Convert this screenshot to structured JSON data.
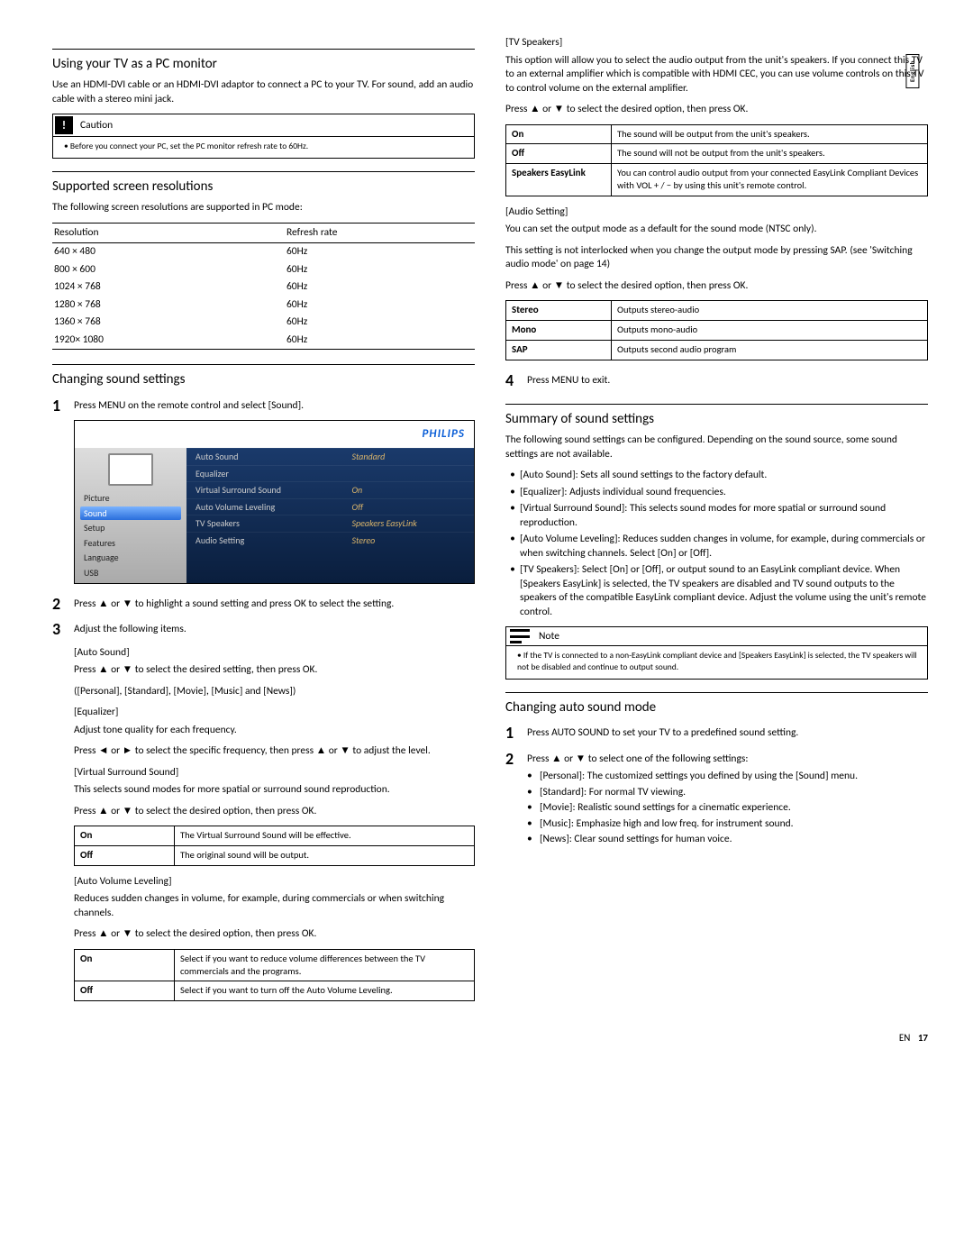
{
  "lang_tab": "English",
  "left": {
    "h1": "Using your TV as a PC monitor",
    "p1": "Use an HDMI-DVI cable or an HDMI-DVI adaptor to connect a PC to your TV. For sound, add an audio cable with a stereo mini jack.",
    "caution_title": "Caution",
    "caution_body": "Before you connect your PC, set the PC monitor refresh rate to 60Hz.",
    "h2": "Supported screen resolutions",
    "p2": "The following screen resolutions are supported in PC mode:",
    "res_headers": [
      "Resolution",
      "Refresh rate"
    ],
    "resolutions": [
      [
        "640 × 480",
        "60Hz"
      ],
      [
        "800 × 600",
        "60Hz"
      ],
      [
        "1024 × 768",
        "60Hz"
      ],
      [
        "1280 × 768",
        "60Hz"
      ],
      [
        "1360 × 768",
        "60Hz"
      ],
      [
        "1920× 1080",
        "60Hz"
      ]
    ],
    "h3": "Changing sound settings",
    "step1": "Press MENU on the remote control and select [Sound].",
    "osd_logo": "PHILIPS",
    "osd_left": [
      "Picture",
      "Sound",
      "Setup",
      "Features",
      "Language",
      "USB"
    ],
    "osd_rows": [
      {
        "lbl": "Auto Sound",
        "val": "Standard"
      },
      {
        "lbl": "Equalizer",
        "val": ""
      },
      {
        "lbl": "Virtual Surround Sound",
        "val": "On"
      },
      {
        "lbl": "Auto Volume Leveling",
        "val": "Off"
      },
      {
        "lbl": "TV Speakers",
        "val": "Speakers EasyLink"
      },
      {
        "lbl": "Audio Setting",
        "val": "Stereo"
      }
    ],
    "step2": "Press ▲ or ▼ to highlight a sound setting and press OK to select the setting.",
    "step3": "Adjust the following items.",
    "autosound_h": "Auto Sound",
    "autosound_p1": "Press ▲ or ▼ to select the desired setting, then press OK.",
    "autosound_p2": "([Personal], [Standard], [Movie], [Music] and [News])",
    "eq_h": "Equalizer",
    "eq_p1": "Adjust tone quality for each frequency.",
    "eq_p2": "Press ◄ or ► to select the specific frequency, then press ▲ or ▼ to adjust the level.",
    "vss_h": "Virtual Surround Sound",
    "vss_p1": "This selects sound modes for more spatial or surround sound reproduction.",
    "vss_p2": "Press ▲ or ▼ to select the desired option, then press OK.",
    "vss_table": [
      [
        "On",
        "The Virtual Surround Sound will be effective."
      ],
      [
        "Off",
        "The original sound will be output."
      ]
    ],
    "avl_h": "Auto Volume Leveling",
    "avl_p1": "Reduces sudden changes in volume, for example, during commercials or when switching channels.",
    "avl_p2": "Press ▲ or ▼ to select the desired option, then press OK.",
    "avl_table": [
      [
        "On",
        "Select if you want to reduce volume differences between the TV commercials and the programs."
      ],
      [
        "Off",
        "Select if you want to turn off the Auto Volume Leveling."
      ]
    ]
  },
  "right": {
    "tvs_h": "TV Speakers",
    "tvs_p1": "This option will allow you to select the audio output from the unit's speakers. If you connect this TV to an external amplifier which is compatible with HDMI CEC, you can use volume controls on this TV to control volume on the external amplifier.",
    "tvs_p2": "Press ▲ or ▼ to select the desired option, then press OK.",
    "tvs_table": [
      [
        "On",
        "The sound will be output from the unit's speakers."
      ],
      [
        "Off",
        "The sound will not be output from the unit's speakers."
      ],
      [
        "Speakers EasyLink",
        "You can control audio output from your connected EasyLink Compliant Devices with VOL + / − by using this unit's remote control."
      ]
    ],
    "aud_h": "Audio Setting",
    "aud_p1": "You can set the output mode as a default for the sound mode (NTSC only).",
    "aud_p2": "This setting is not interlocked when you change the output mode by pressing SAP. (see 'Switching audio mode' on page 14)",
    "aud_p3": "Press ▲ or ▼ to select the desired option, then press OK.",
    "aud_table": [
      [
        "Stereo",
        "Outputs stereo-audio"
      ],
      [
        "Mono",
        "Outputs mono-audio"
      ],
      [
        "SAP",
        "Outputs second audio program"
      ]
    ],
    "step4": "Press MENU to exit.",
    "h4": "Summary of sound settings",
    "p4": "The following sound settings can be configured. Depending on the sound source, some sound settings are not available.",
    "summary": [
      "[Auto Sound]: Sets all sound settings to the factory default.",
      "[Equalizer]: Adjusts individual sound frequencies.",
      "[Virtual Surround Sound]: This selects sound modes for more spatial or surround sound reproduction.",
      "[Auto Volume Leveling]: Reduces sudden changes in volume, for example, during commercials or when switching channels. Select [On] or [Off].",
      "[TV Speakers]: Select [On] or [Off], or output sound to an EasyLink compliant device. When [Speakers EasyLink] is selected, the TV speakers are disabled and TV sound outputs to the speakers of the compatible EasyLink compliant device. Adjust the volume using the unit's remote control."
    ],
    "note_title": "Note",
    "note_body": "If the TV is connected to a non-EasyLink compliant device and [Speakers EasyLink] is selected, the TV speakers will not be disabled and continue to output sound.",
    "h5": "Changing auto sound mode",
    "cas_step1": "Press AUTO SOUND to set your TV to a predefined sound setting.",
    "cas_step2": "Press ▲ or ▼ to select one of the following settings:",
    "cas_list": [
      "[Personal]: The customized settings you defined by using the [Sound] menu.",
      "[Standard]: For normal TV viewing.",
      "[Movie]: Realistic sound settings for a cinematic experience.",
      "[Music]: Emphasize high and low freq. for instrument sound.",
      "[News]: Clear sound settings for human voice."
    ]
  },
  "footer": {
    "region": "EN",
    "page": "17"
  }
}
